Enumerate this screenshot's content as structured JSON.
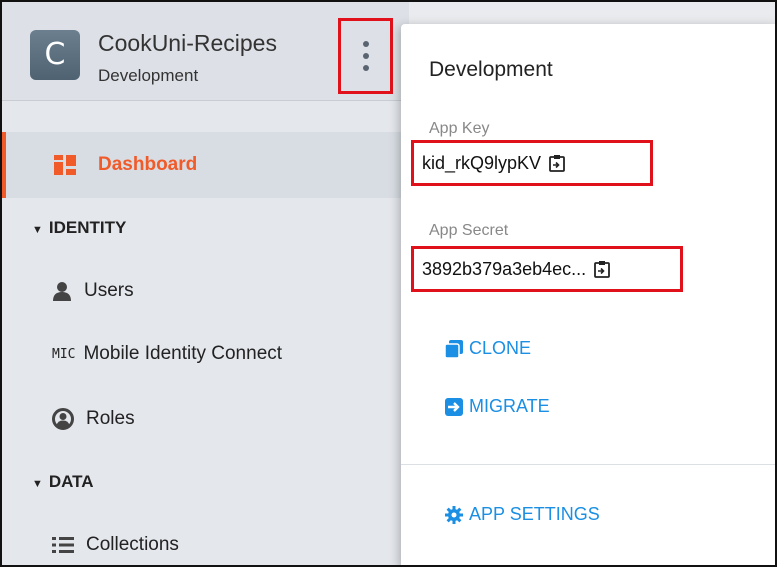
{
  "app": {
    "initial": "C",
    "name": "CookUni-Recipes",
    "environment": "Development"
  },
  "nav": {
    "dashboard": "Dashboard",
    "identity_section": "IDENTITY",
    "users": "Users",
    "mic_icon_text": "MIC",
    "mobile_identity_connect": "Mobile Identity Connect",
    "roles": "Roles",
    "data_section": "DATA",
    "collections": "Collections"
  },
  "panel": {
    "title": "Development",
    "app_key_label": "App Key",
    "app_key_value": "kid_rkQ9lypKV",
    "app_secret_label": "App Secret",
    "app_secret_value": "3892b379a3eb4ec...",
    "clone": "CLONE",
    "migrate": "MIGRATE",
    "app_settings": "APP SETTINGS"
  },
  "colors": {
    "accent_orange": "#f15a29",
    "link_blue": "#1a8fe3",
    "highlight_red": "#e0111b"
  }
}
